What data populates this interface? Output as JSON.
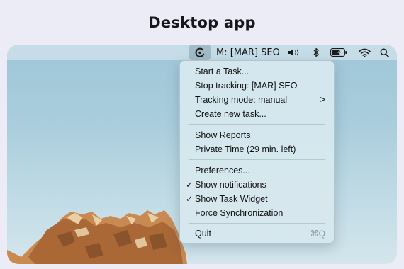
{
  "page": {
    "title": "Desktop app"
  },
  "menubar": {
    "tracking_label": "M: [MAR] SEO",
    "icons": [
      "app-logo-icon",
      "speaker-icon",
      "bluetooth-icon",
      "battery-charging-icon",
      "wifi-icon",
      "search-icon"
    ]
  },
  "menu": {
    "items": [
      {
        "label": "Start a Task..."
      },
      {
        "label": "Stop tracking: [MAR] SEO"
      },
      {
        "label": "Tracking mode: manual",
        "submenu": ">"
      },
      {
        "label": "Create new task..."
      },
      {
        "label": "Show Reports"
      },
      {
        "label": "Private Time (29 min. left)"
      },
      {
        "label": "Preferences..."
      },
      {
        "label": "Show notifications",
        "check": "✓"
      },
      {
        "label": "Show Task Widget",
        "check": "✓"
      },
      {
        "label": "Force Synchronization"
      },
      {
        "label": "Quit",
        "shortcut": "⌘Q"
      }
    ]
  },
  "colors": {
    "background": "#ececf6",
    "menu_bg": "#d6e8ee",
    "sky": "#a9cddc"
  }
}
